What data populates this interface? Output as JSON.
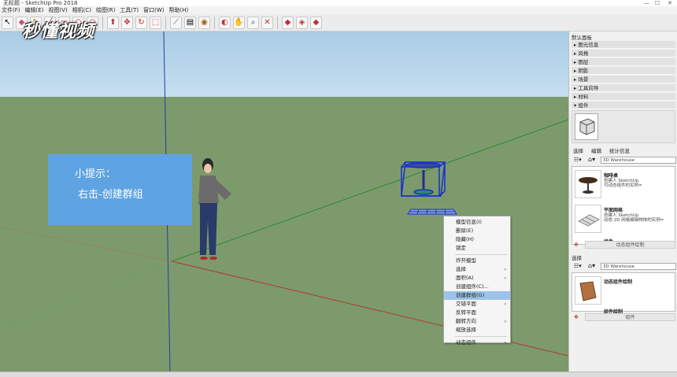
{
  "window": {
    "title": "无标题 - SketchUp Pro 2018",
    "controls": [
      "—",
      "☐",
      "✕"
    ]
  },
  "menus": [
    "文件(F)",
    "编辑(E)",
    "视图(V)",
    "相机(C)",
    "绘图(R)",
    "工具(T)",
    "窗口(W)",
    "帮助(H)"
  ],
  "toolbar": {
    "icons": [
      "select-arrow-icon",
      "eraser-icon",
      "pencil-icon",
      "line-icon",
      "rectangle-icon",
      "circle-icon",
      "arc-icon",
      "push-pull-icon",
      "move-icon",
      "rotate-icon",
      "scale-icon",
      "offset-icon",
      "tape-measure-icon",
      "text-icon",
      "paint-bucket-icon",
      "orbit-icon",
      "pan-icon",
      "zoom-icon",
      "zoom-extents-icon",
      "warehouse-icon",
      "extension-icon",
      "share-icon"
    ]
  },
  "watermark": {
    "text": "秒懂视频"
  },
  "tip": {
    "line1": "小提示：",
    "line2": "右击-创建群组"
  },
  "context_menu": {
    "items": [
      {
        "label": "模型信息(I)",
        "submenu": false,
        "highlighted": false,
        "sep_before": false
      },
      {
        "label": "删除(E)",
        "submenu": false,
        "highlighted": false,
        "sep_before": false
      },
      {
        "label": "隐藏(H)",
        "submenu": false,
        "highlighted": false,
        "sep_before": false
      },
      {
        "label": "锁定",
        "submenu": false,
        "highlighted": false,
        "sep_before": false
      },
      {
        "label": "炸开模型",
        "submenu": false,
        "highlighted": false,
        "sep_before": true
      },
      {
        "label": "选择",
        "submenu": true,
        "highlighted": false,
        "sep_before": false
      },
      {
        "label": "面积(A)",
        "submenu": true,
        "highlighted": false,
        "sep_before": false
      },
      {
        "label": "创建组件(C)...",
        "submenu": false,
        "highlighted": false,
        "sep_before": false
      },
      {
        "label": "创建群组(G)",
        "submenu": false,
        "highlighted": true,
        "sep_before": false
      },
      {
        "label": "交错平面",
        "submenu": true,
        "highlighted": false,
        "sep_before": false
      },
      {
        "label": "反转平面",
        "submenu": false,
        "highlighted": false,
        "sep_before": false
      },
      {
        "label": "翻转方向",
        "submenu": true,
        "highlighted": false,
        "sep_before": false
      },
      {
        "label": "缩放选择",
        "submenu": false,
        "highlighted": false,
        "sep_before": false
      },
      {
        "label": "动态组件",
        "submenu": true,
        "highlighted": false,
        "sep_before": true
      }
    ]
  },
  "tray": {
    "title": "默认面板",
    "sections": [
      "图元信息",
      "风格",
      "图层",
      "阴影",
      "场景",
      "工具向导",
      "材料",
      "组件"
    ],
    "tabs": [
      "选择",
      "编辑",
      "统计信息"
    ],
    "search_placeholder": "3D Warehouse",
    "entries": [
      {
        "title": "咖啡桌",
        "desc1": "创建人 SketchUp",
        "desc2": "可动态组件的实例="
      },
      {
        "title": "平面网格",
        "desc1": "创建人 SketchUp",
        "desc2": "动态 2D 网格编辑物体的实例="
      },
      {
        "title": "组件",
        "desc1": "",
        "desc2": ""
      }
    ],
    "footer1": "动态组件绘制",
    "section2_label": "选择",
    "search2_placeholder": "3D Warehouse",
    "entry2": {
      "title": "动态组件绘制"
    },
    "entry2_next": "组件绘制",
    "footer2": "组件"
  }
}
